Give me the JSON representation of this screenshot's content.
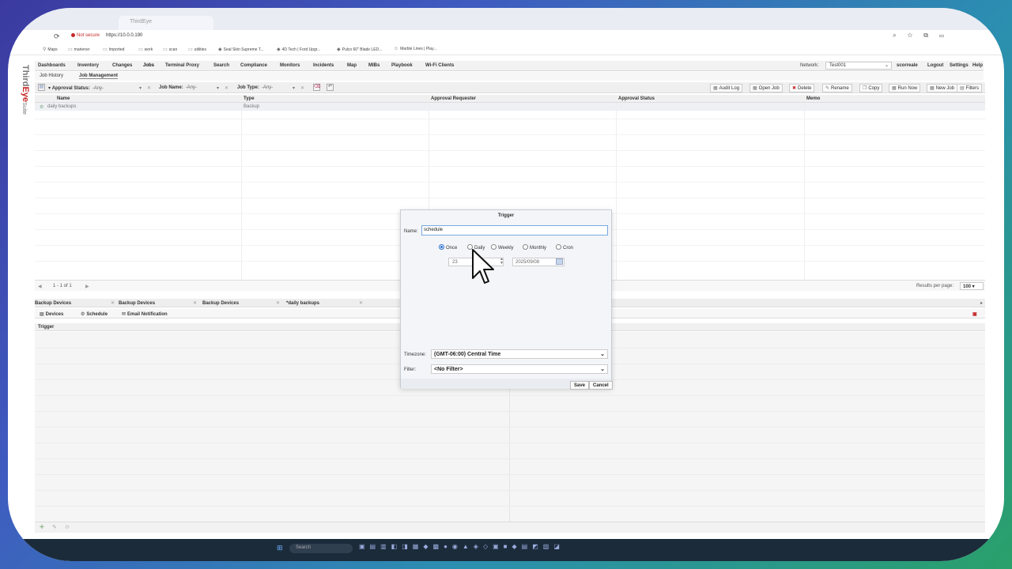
{
  "browser": {
    "tab_title": "ThirdEye",
    "security": "Not secure",
    "url": "https://10.0.0.190",
    "bookmarks": [
      "Maps",
      "mariener",
      "Imported",
      "work",
      "scan",
      "utilities",
      "Seal Skin Supreme T...",
      "4D Tech | Ford Upgr...",
      "Pulco 60\" Blade LED...",
      "Marble Lines | Play..."
    ]
  },
  "brand": {
    "part1": "Third",
    "part2": "Eye",
    "part3": "Suite"
  },
  "menu": [
    "Dashboards",
    "Inventory",
    "Changes",
    "Jobs",
    "Terminal Proxy",
    "Search",
    "Compliance",
    "Monitors",
    "Incidents",
    "Map",
    "MIBs",
    "Playbook",
    "Wi-Fi Clients"
  ],
  "network": {
    "label": "Network:",
    "value": "Test001"
  },
  "user": {
    "name": "scorreale",
    "logout": "Logout",
    "settings": "Settings",
    "help": "Help"
  },
  "subtabs": [
    "Job History",
    "Job Management"
  ],
  "filters": {
    "approval_status": "Approval Status:",
    "approval_val": "-Any-",
    "job_name": "Job Name:",
    "job_name_val": "-Any-",
    "job_type": "Job Type:",
    "job_type_val": "-Any-"
  },
  "actions": [
    "Audit Log",
    "Open Job",
    "Delete",
    "Rename",
    "Copy",
    "Run Now",
    "New Job",
    "Filters"
  ],
  "grid": {
    "columns": [
      "Name",
      "Type",
      "Approval Requester",
      "Approval Status",
      "Memo"
    ],
    "rows": [
      {
        "name": "daily backups",
        "type": "Backup"
      }
    ]
  },
  "pager": {
    "range": "1 - 1 of 1",
    "per_page_label": "Results per page:",
    "per_page": "100"
  },
  "bottom_tabs": [
    "Backup Devices",
    "Backup Devices",
    "Backup Devices",
    "*daily backups"
  ],
  "bottom_subtabs": [
    "Devices",
    "Schedule",
    "Email Notification"
  ],
  "trigger_column": "Trigger",
  "dialog": {
    "title": "Trigger",
    "name_label": "Name:",
    "name_value": "schedule",
    "frequencies": [
      "Once",
      "Daily",
      "Weekly",
      "Monthly",
      "Cron"
    ],
    "selected_frequency": "Once",
    "hour": "23",
    "date": "2025/09/08",
    "timezone_label": "Timezone:",
    "timezone": "(GMT-06:00) Central Time",
    "filter_label": "Filter:",
    "filter": "<No Filter>",
    "save": "Save",
    "cancel": "Cancel"
  },
  "taskbar": {
    "search": "Search"
  }
}
